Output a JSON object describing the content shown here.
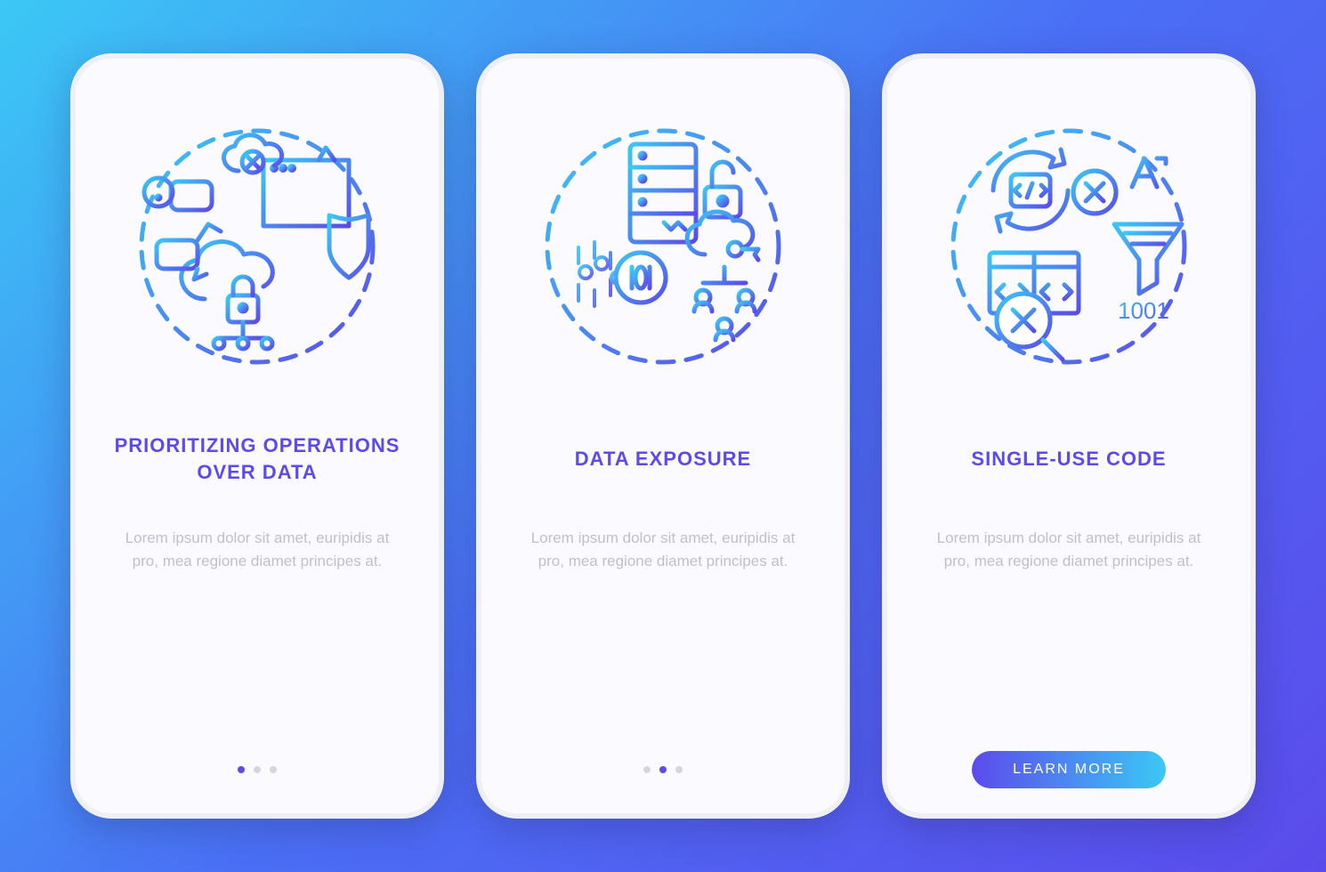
{
  "screens": [
    {
      "title": "PRIORITIZING OPERATIONS OVER DATA",
      "description": "Lorem ipsum dolor sit amet, euripidis at pro, mea regione diamet principes at.",
      "activeDot": 0,
      "hasCta": false
    },
    {
      "title": "DATA EXPOSURE",
      "description": "Lorem ipsum dolor sit amet, euripidis at pro, mea regione diamet principes at.",
      "activeDot": 1,
      "hasCta": false
    },
    {
      "title": "SINGLE-USE CODE",
      "description": "Lorem ipsum dolor sit amet, euripidis at pro, mea regione diamet principes at.",
      "activeDot": 2,
      "hasCta": true,
      "ctaLabel": "LEARN MORE"
    }
  ],
  "colors": {
    "accentPurple": "#5B4BEC",
    "accentCyan": "#3BC8F5",
    "textMuted": "#bfc0cc"
  }
}
